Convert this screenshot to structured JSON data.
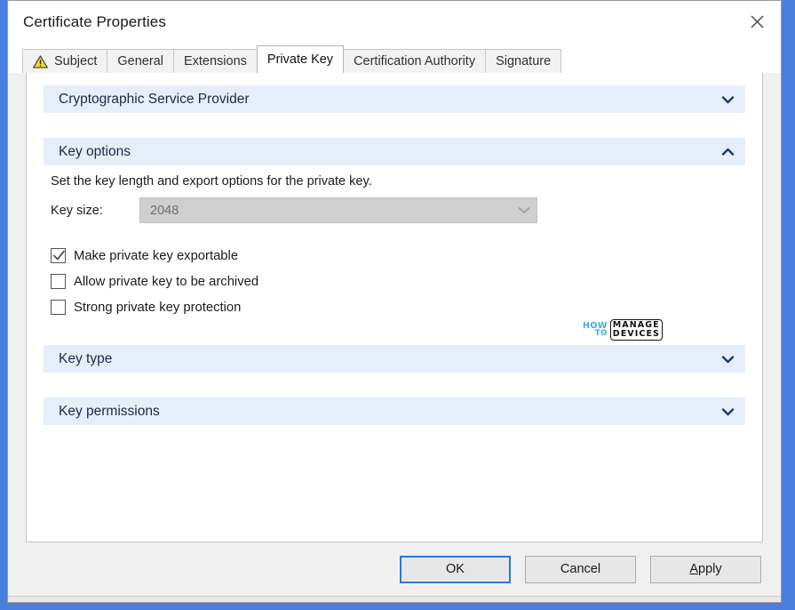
{
  "window": {
    "title": "Certificate Properties",
    "close_icon": "close-icon"
  },
  "tabs": [
    {
      "label": "Subject",
      "icon": "warning-triangle-icon",
      "active": false
    },
    {
      "label": "General",
      "active": false
    },
    {
      "label": "Extensions",
      "active": false
    },
    {
      "label": "Private Key",
      "active": true
    },
    {
      "label": "Certification Authority",
      "active": false
    },
    {
      "label": "Signature",
      "active": false
    }
  ],
  "sections": {
    "csp": {
      "title": "Cryptographic Service Provider",
      "state": "collapsed",
      "chevron": "chevron-down-icon"
    },
    "key_options": {
      "title": "Key options",
      "state": "expanded",
      "chevron": "chevron-up-icon",
      "description": "Set the key length and export options for the private key.",
      "key_size": {
        "label": "Key size:",
        "value": "2048",
        "disabled": true,
        "arrow": "chevron-down-icon"
      },
      "checkboxes": [
        {
          "label": "Make private key exportable",
          "checked": true
        },
        {
          "label": "Allow private key to be archived",
          "checked": false
        },
        {
          "label": "Strong private key protection",
          "checked": false
        }
      ]
    },
    "key_type": {
      "title": "Key type",
      "state": "collapsed",
      "chevron": "chevron-down-icon"
    },
    "key_permissions": {
      "title": "Key permissions",
      "state": "collapsed",
      "chevron": "chevron-down-icon"
    }
  },
  "watermark": {
    "how": "HOW",
    "to": "TO",
    "manage": "MANAGE",
    "devices": "DEVICES"
  },
  "buttons": {
    "ok": "OK",
    "cancel": "Cancel",
    "apply_prefix": "A",
    "apply_rest": "pply"
  },
  "colors": {
    "desktop_blue": "#4a7fe0",
    "section_header_bg": "#e4effa",
    "section_header_text": "#1d2a44",
    "default_button_border": "#2a7ad2",
    "warning_yellow": "#f5d800",
    "watermark_cyan": "#3aafe0"
  }
}
